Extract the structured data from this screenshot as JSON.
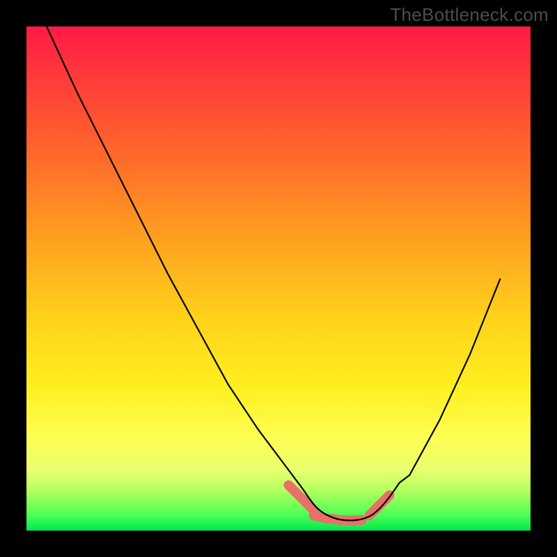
{
  "watermark": "TheBottleneck.com",
  "chart_data": {
    "type": "line",
    "title": "",
    "xlabel": "",
    "ylabel": "",
    "xlim": [
      0,
      100
    ],
    "ylim": [
      0,
      100
    ],
    "grid": false,
    "legend": false,
    "background_gradient": {
      "direction": "vertical",
      "stops": [
        {
          "pos": 0.0,
          "color": "#ff1a46"
        },
        {
          "pos": 0.6,
          "color": "#ffd21a"
        },
        {
          "pos": 0.88,
          "color": "#e8ff6e"
        },
        {
          "pos": 1.0,
          "color": "#00e84d"
        }
      ]
    },
    "series": [
      {
        "name": "bottleneck-curve",
        "x": [
          4,
          10,
          16,
          22,
          28,
          34,
          40,
          46,
          52,
          55,
          58,
          61,
          64,
          67,
          70,
          76,
          82,
          88,
          94
        ],
        "y": [
          100,
          87,
          75,
          63,
          51,
          40,
          29,
          20,
          12,
          8,
          5,
          3,
          2,
          2,
          4,
          11,
          22,
          35,
          50
        ],
        "color": "#000000"
      }
    ],
    "annotations": [
      {
        "name": "left-marker",
        "type": "thick-segment",
        "x": [
          52,
          57
        ],
        "y": [
          9,
          4
        ],
        "color": "#e77169"
      },
      {
        "name": "trough-markers",
        "type": "thick-dots",
        "x": [
          57,
          59,
          61,
          63,
          65,
          67
        ],
        "y": [
          3,
          2.5,
          2.2,
          2,
          2,
          2.2
        ],
        "color": "#e77169"
      },
      {
        "name": "right-marker",
        "type": "thick-segment",
        "x": [
          68,
          72
        ],
        "y": [
          3,
          7
        ],
        "color": "#e77169"
      }
    ]
  }
}
